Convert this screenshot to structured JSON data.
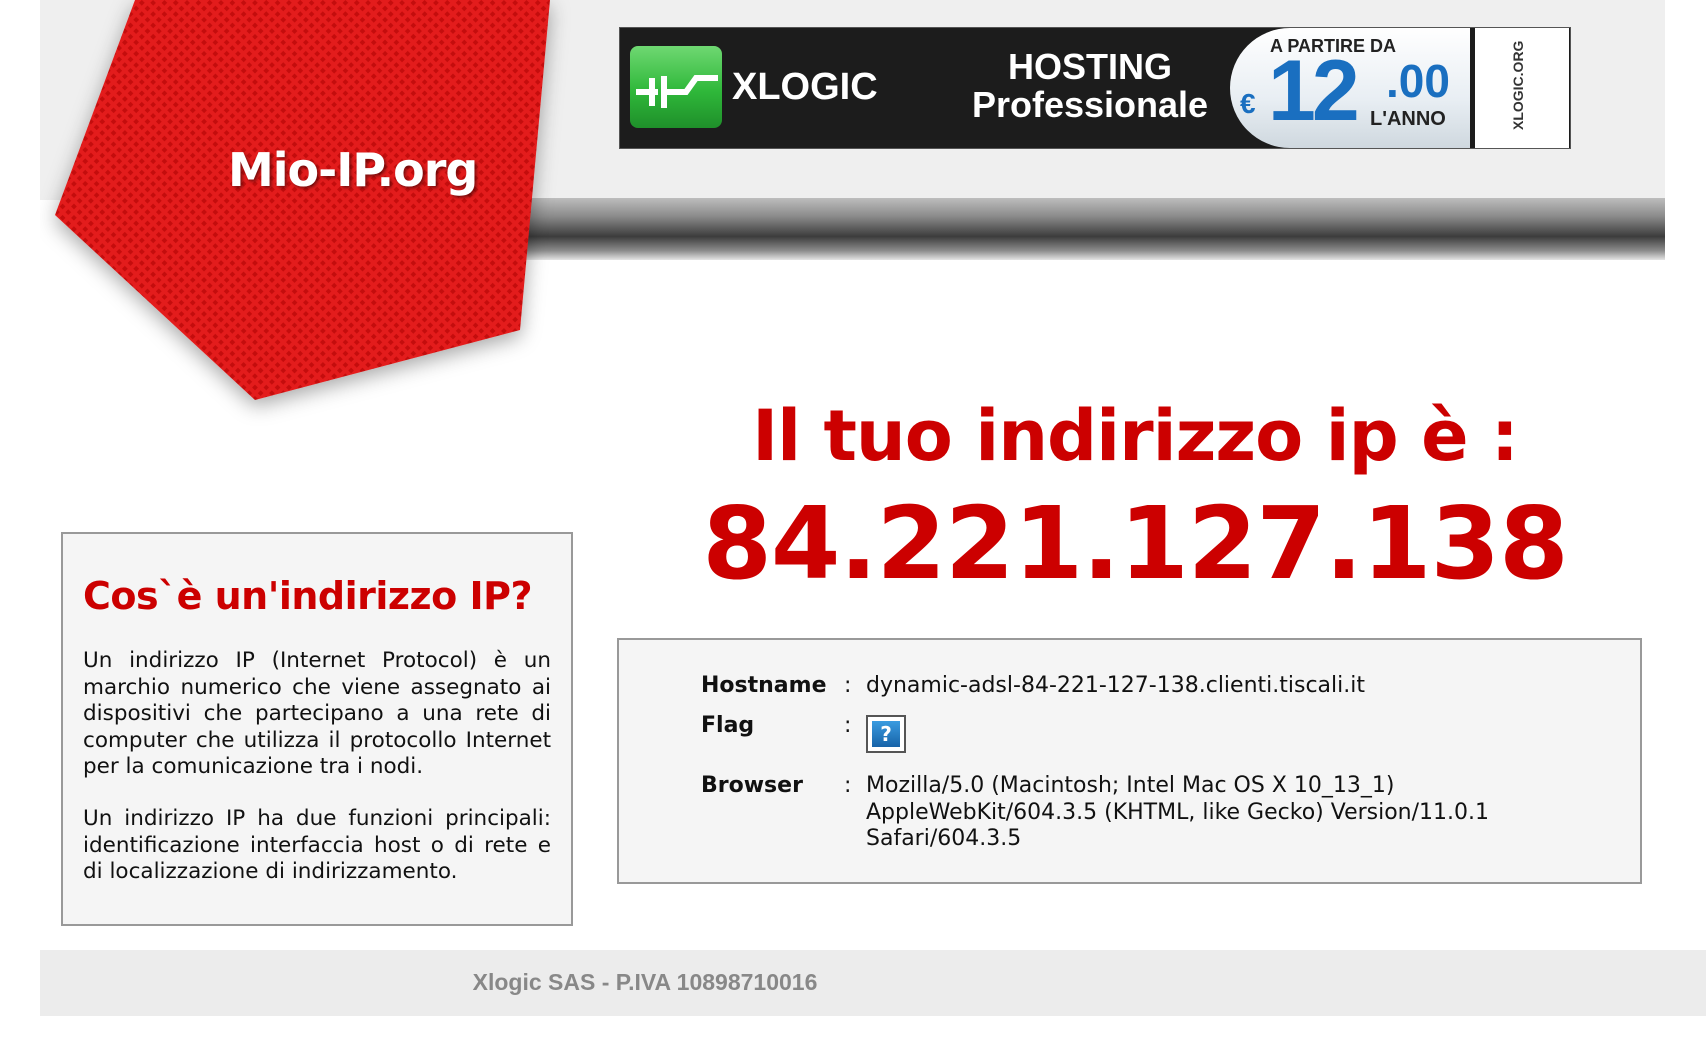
{
  "site": {
    "logo_text": "Mio-IP.org",
    "brand_color": "#dd1111"
  },
  "banner": {
    "brand": "XLOGIC",
    "line1": "HOSTING",
    "line2": "Professionale",
    "price_prefix": "A PARTIRE DA",
    "currency": "€",
    "price_int": "12",
    "price_dec": ".00",
    "price_period": "L'ANNO",
    "side_text": "XLOGIC.ORG"
  },
  "main": {
    "headline": "Il tuo indirizzo ip è :",
    "ip": "84.221.127.138",
    "accent_color": "#cc0000"
  },
  "info": {
    "title": "Cos`è un'indirizzo IP?",
    "paragraph1": "Un indirizzo IP (Internet Protocol) è un marchio numerico che viene assegnato ai dispositivi che partecipano a una rete di computer che utilizza il protocollo Internet per la comunicazione tra i nodi.",
    "paragraph2": "Un indirizzo IP ha due funzioni principali: identificazione interfaccia host o di rete e di localizzazione di indirizzamento."
  },
  "details": {
    "separator": ":",
    "hostname_label": "Hostname",
    "hostname_value": "dynamic-adsl-84-221-127-138.clienti.tiscali.it",
    "flag_label": "Flag",
    "flag_icon": "question-mark-icon",
    "flag_glyph": "?",
    "browser_label": "Browser",
    "browser_value": "Mozilla/5.0 (Macintosh; Intel Mac OS X 10_13_1) AppleWebKit/604.3.5 (KHTML, like Gecko) Version/11.0.1 Safari/604.3.5"
  },
  "footer": {
    "text": "Xlogic SAS - P.IVA 10898710016"
  }
}
